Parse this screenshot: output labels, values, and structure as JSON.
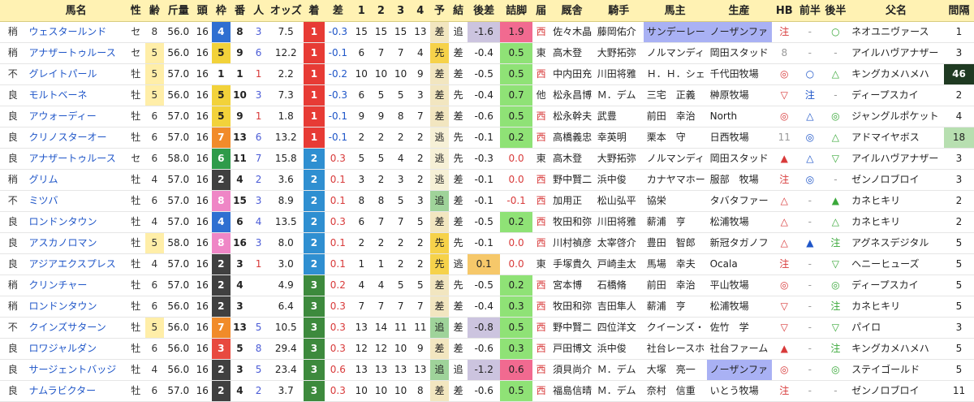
{
  "header": [
    "",
    "馬名",
    "性",
    "齢",
    "斤量",
    "頭",
    "枠",
    "番",
    "人",
    "オッズ",
    "着",
    "差",
    "1",
    "2",
    "3",
    "4",
    "予",
    "結",
    "後差",
    "詰脚",
    "届",
    "厩舎",
    "騎手",
    "馬主",
    "生産",
    "HB",
    "前半",
    "後半",
    "父名",
    "間隔"
  ],
  "colors": {
    "header_bg": "#fff2b3",
    "waku": {
      "1": "#ffffff",
      "2": "#404040",
      "3": "#e84a3f",
      "4": "#2f6fd1",
      "5": "#f2d23a",
      "6": "#2f9b4a",
      "7": "#f18b2a",
      "8": "#ef86c6"
    },
    "chaku": {
      "1": "#e73b35",
      "2": "#2f8fd1",
      "3": "#3d8a3d"
    },
    "yoso": {
      "差": "#f2e6c0",
      "先": "#f6d24a",
      "逃": "#f6f0d6",
      "追": "#9fd39a"
    },
    "kekka": {
      "差": "#f2e6c0",
      "先": "#f6d24a",
      "逃": "#f6f0d6",
      "追": "#9fd39a"
    },
    "goshi_strong": "#ccc4df",
    "tsume_high": "#f16a90",
    "tsume_good": "#8fe276",
    "tsume_neutral": "#ffffff"
  },
  "rows": [
    {
      "baba": "稍",
      "name": "ウェスタールンド",
      "sex": "セ",
      "age": "8",
      "kinryo": "56.0",
      "heads": "16",
      "waku": "4",
      "ban": "8",
      "pop": "3",
      "odds": "7.5",
      "chaku": "1",
      "sa": "-0.3",
      "c1": "15",
      "c2": "15",
      "c3": "15",
      "c4": "13",
      "yoso": "差",
      "kekka": "追",
      "goshi": "-1.6",
      "tsume": "1.9",
      "todoke": "西",
      "kyusha": "佐々木晶",
      "kishu": "藤岡佑介",
      "owner": "サンデーレー",
      "breeder": "ノーザンファ",
      "hb": "注",
      "zen": "-",
      "kou": "○",
      "father": "ネオユニヴァース",
      "kankaku": "1",
      "owner_hl": true,
      "breeder_hl": true,
      "goshi_hl": true,
      "tsume_hl": "high"
    },
    {
      "baba": "稍",
      "name": "アナザートゥルース",
      "sex": "セ",
      "age": "5",
      "kinryo": "56.0",
      "heads": "16",
      "waku": "5",
      "ban": "9",
      "pop": "6",
      "odds": "12.2",
      "chaku": "1",
      "sa": "-0.1",
      "c1": "6",
      "c2": "7",
      "c3": "7",
      "c4": "4",
      "yoso": "先",
      "kekka": "差",
      "goshi": "-0.4",
      "tsume": "0.5",
      "todoke": "東",
      "kyusha": "高木登",
      "kishu": "大野拓弥",
      "owner": "ノルマンディ",
      "breeder": "岡田スタッド",
      "hb": "8",
      "zen": "-",
      "kou": "-",
      "father": "アイルハヴアナザー",
      "kankaku": "3",
      "tsume_hl": "good"
    },
    {
      "baba": "不",
      "name": "グレイトパール",
      "sex": "牡",
      "age": "5",
      "kinryo": "57.0",
      "heads": "16",
      "waku": "1",
      "ban": "1",
      "pop": "1",
      "odds": "2.2",
      "chaku": "1",
      "sa": "-0.2",
      "c1": "10",
      "c2": "10",
      "c3": "10",
      "c4": "9",
      "yoso": "差",
      "kekka": "差",
      "goshi": "-0.5",
      "tsume": "0.5",
      "todoke": "西",
      "kyusha": "中内田充",
      "kishu": "川田将雅",
      "owner": "Ｈ．Ｈ．シェ",
      "breeder": "千代田牧場",
      "hb": "◎",
      "zen": "○",
      "kou": "△",
      "father": "キングカメハメハ",
      "kankaku": "46",
      "tsume_hl": "good",
      "kankaku_hl": "dark"
    },
    {
      "baba": "良",
      "name": "モルトベーネ",
      "sex": "牡",
      "age": "5",
      "kinryo": "56.0",
      "heads": "16",
      "waku": "5",
      "ban": "10",
      "pop": "3",
      "odds": "7.3",
      "chaku": "1",
      "sa": "-0.3",
      "c1": "6",
      "c2": "5",
      "c3": "5",
      "c4": "3",
      "yoso": "差",
      "kekka": "先",
      "goshi": "-0.4",
      "tsume": "0.7",
      "todoke": "他",
      "kyusha": "松永昌博",
      "kishu": "Ｍ．デム",
      "owner": "三宅　正義",
      "breeder": "榊原牧場",
      "hb": "▽",
      "zen": "注",
      "kou": "-",
      "father": "ディープスカイ",
      "kankaku": "2",
      "tsume_hl": "good"
    },
    {
      "baba": "良",
      "name": "アウォーディー",
      "sex": "牡",
      "age": "6",
      "kinryo": "57.0",
      "heads": "16",
      "waku": "5",
      "ban": "9",
      "pop": "1",
      "odds": "1.8",
      "chaku": "1",
      "sa": "-0.1",
      "c1": "9",
      "c2": "9",
      "c3": "8",
      "c4": "7",
      "yoso": "差",
      "kekka": "差",
      "goshi": "-0.6",
      "tsume": "0.5",
      "todoke": "西",
      "kyusha": "松永幹夫",
      "kishu": "武豊",
      "owner": "前田　幸治",
      "breeder": "North",
      "hb": "◎",
      "zen": "△",
      "kou": "◎",
      "father": "ジャングルポケット",
      "kankaku": "4",
      "tsume_hl": "good"
    },
    {
      "baba": "良",
      "name": "クリノスターオー",
      "sex": "牡",
      "age": "6",
      "kinryo": "57.0",
      "heads": "16",
      "waku": "7",
      "ban": "13",
      "pop": "6",
      "odds": "13.2",
      "chaku": "1",
      "sa": "-0.1",
      "c1": "2",
      "c2": "2",
      "c3": "2",
      "c4": "2",
      "yoso": "逃",
      "kekka": "先",
      "goshi": "-0.1",
      "tsume": "0.2",
      "todoke": "西",
      "kyusha": "高橋義忠",
      "kishu": "幸英明",
      "owner": "栗本　守",
      "breeder": "日西牧場",
      "hb": "11",
      "zen": "◎",
      "kou": "△",
      "father": "アドマイヤボス",
      "kankaku": "18",
      "tsume_hl": "good",
      "kankaku_hl": "light"
    },
    {
      "baba": "良",
      "name": "アナザートゥルース",
      "sex": "セ",
      "age": "6",
      "kinryo": "58.0",
      "heads": "16",
      "waku": "6",
      "ban": "11",
      "pop": "7",
      "odds": "15.8",
      "chaku": "2",
      "sa": "0.3",
      "c1": "5",
      "c2": "5",
      "c3": "4",
      "c4": "2",
      "yoso": "逃",
      "kekka": "先",
      "goshi": "-0.3",
      "tsume": "0.0",
      "todoke": "東",
      "kyusha": "高木登",
      "kishu": "大野拓弥",
      "owner": "ノルマンディ",
      "breeder": "岡田スタッド",
      "hb": "▲",
      "zen": "△",
      "kou": "▽",
      "father": "アイルハヴアナザー",
      "kankaku": "3"
    },
    {
      "baba": "稍",
      "name": "グリム",
      "sex": "牡",
      "age": "4",
      "kinryo": "57.0",
      "heads": "16",
      "waku": "2",
      "ban": "4",
      "pop": "2",
      "odds": "3.6",
      "chaku": "2",
      "sa": "0.1",
      "c1": "3",
      "c2": "2",
      "c3": "3",
      "c4": "2",
      "yoso": "逃",
      "kekka": "差",
      "goshi": "-0.1",
      "tsume": "0.0",
      "todoke": "西",
      "kyusha": "野中賢二",
      "kishu": "浜中俊",
      "owner": "カナヤマホー",
      "breeder": "服部　牧場",
      "hb": "注",
      "zen": "◎",
      "kou": "-",
      "father": "ゼンノロブロイ",
      "kankaku": "3"
    },
    {
      "baba": "不",
      "name": "ミツバ",
      "sex": "牡",
      "age": "6",
      "kinryo": "57.0",
      "heads": "16",
      "waku": "8",
      "ban": "15",
      "pop": "3",
      "odds": "8.9",
      "chaku": "2",
      "sa": "0.1",
      "c1": "8",
      "c2": "8",
      "c3": "5",
      "c4": "3",
      "yoso": "追",
      "kekka": "差",
      "goshi": "-0.1",
      "tsume": "-0.1",
      "todoke": "西",
      "kyusha": "加用正",
      "kishu": "松山弘平",
      "owner": "協栄",
      "breeder": "タバタファー",
      "hb": "△",
      "zen": "-",
      "kou": "▲",
      "father": "カネヒキリ",
      "kankaku": "2"
    },
    {
      "baba": "良",
      "name": "ロンドンタウン",
      "sex": "牡",
      "age": "4",
      "kinryo": "57.0",
      "heads": "16",
      "waku": "4",
      "ban": "6",
      "pop": "4",
      "odds": "13.5",
      "chaku": "2",
      "sa": "0.3",
      "c1": "6",
      "c2": "7",
      "c3": "7",
      "c4": "5",
      "yoso": "差",
      "kekka": "差",
      "goshi": "-0.5",
      "tsume": "0.2",
      "todoke": "西",
      "kyusha": "牧田和弥",
      "kishu": "川田将雅",
      "owner": "薪浦　亨",
      "breeder": "松浦牧場",
      "hb": "△",
      "zen": "-",
      "kou": "△",
      "father": "カネヒキリ",
      "kankaku": "2",
      "tsume_hl": "good"
    },
    {
      "baba": "良",
      "name": "アスカノロマン",
      "sex": "牡",
      "age": "5",
      "kinryo": "58.0",
      "heads": "16",
      "waku": "8",
      "ban": "16",
      "pop": "3",
      "odds": "8.0",
      "chaku": "2",
      "sa": "0.1",
      "c1": "2",
      "c2": "2",
      "c3": "2",
      "c4": "2",
      "yoso": "先",
      "kekka": "先",
      "goshi": "-0.1",
      "tsume": "0.0",
      "todoke": "西",
      "kyusha": "川村禎彦",
      "kishu": "太宰啓介",
      "owner": "豊田　智郎",
      "breeder": "新冠タガノフ",
      "hb": "△",
      "zen": "▲",
      "kou": "注",
      "father": "アグネスデジタル",
      "kankaku": "5"
    },
    {
      "baba": "良",
      "name": "アジアエクスプレス",
      "sex": "牡",
      "age": "4",
      "kinryo": "57.0",
      "heads": "16",
      "waku": "2",
      "ban": "3",
      "pop": "1",
      "odds": "3.0",
      "chaku": "2",
      "sa": "0.1",
      "c1": "1",
      "c2": "1",
      "c3": "2",
      "c4": "2",
      "yoso": "先",
      "kekka": "逃",
      "goshi": "0.1",
      "tsume": "0.0",
      "todoke": "東",
      "kyusha": "手塚貴久",
      "kishu": "戸崎圭太",
      "owner": "馬場　幸夫",
      "breeder": "Ocala",
      "hb": "注",
      "zen": "-",
      "kou": "▽",
      "father": "ヘニーヒューズ",
      "kankaku": "5",
      "goshi_hl": "orange"
    },
    {
      "baba": "稍",
      "name": "クリンチャー",
      "sex": "牡",
      "age": "6",
      "kinryo": "57.0",
      "heads": "16",
      "waku": "2",
      "ban": "4",
      "pop": "",
      "odds": "4.9",
      "chaku": "3",
      "sa": "0.2",
      "c1": "4",
      "c2": "4",
      "c3": "5",
      "c4": "5",
      "yoso": "差",
      "kekka": "先",
      "goshi": "-0.5",
      "tsume": "0.2",
      "todoke": "西",
      "kyusha": "宮本博",
      "kishu": "石橋脩",
      "owner": "前田　幸治",
      "breeder": "平山牧場",
      "hb": "◎",
      "zen": "-",
      "kou": "◎",
      "father": "ディープスカイ",
      "kankaku": "5",
      "tsume_hl": "good"
    },
    {
      "baba": "稍",
      "name": "ロンドンタウン",
      "sex": "牡",
      "age": "6",
      "kinryo": "56.0",
      "heads": "16",
      "waku": "2",
      "ban": "3",
      "pop": "",
      "odds": "6.4",
      "chaku": "3",
      "sa": "0.3",
      "c1": "7",
      "c2": "7",
      "c3": "7",
      "c4": "7",
      "yoso": "差",
      "kekka": "差",
      "goshi": "-0.4",
      "tsume": "0.3",
      "todoke": "西",
      "kyusha": "牧田和弥",
      "kishu": "吉田隼人",
      "owner": "薪浦　亨",
      "breeder": "松浦牧場",
      "hb": "▽",
      "zen": "-",
      "kou": "注",
      "father": "カネヒキリ",
      "kankaku": "5",
      "tsume_hl": "good"
    },
    {
      "baba": "不",
      "name": "クインズサターン",
      "sex": "牡",
      "age": "5",
      "kinryo": "56.0",
      "heads": "16",
      "waku": "7",
      "ban": "13",
      "pop": "5",
      "odds": "10.5",
      "chaku": "3",
      "sa": "0.3",
      "c1": "13",
      "c2": "14",
      "c3": "11",
      "c4": "11",
      "yoso": "追",
      "kekka": "差",
      "goshi": "-0.8",
      "tsume": "0.5",
      "todoke": "西",
      "kyusha": "野中賢二",
      "kishu": "四位洋文",
      "owner": "クイーンズ・",
      "breeder": "佐竹　学",
      "hb": "▽",
      "zen": "-",
      "kou": "▽",
      "father": "パイロ",
      "kankaku": "3",
      "tsume_hl": "good",
      "goshi_hl": true
    },
    {
      "baba": "良",
      "name": "ロワジャルダン",
      "sex": "牡",
      "age": "6",
      "kinryo": "56.0",
      "heads": "16",
      "waku": "3",
      "ban": "5",
      "pop": "8",
      "odds": "29.4",
      "chaku": "3",
      "sa": "0.3",
      "c1": "12",
      "c2": "12",
      "c3": "10",
      "c4": "9",
      "yoso": "差",
      "kekka": "差",
      "goshi": "-0.6",
      "tsume": "0.3",
      "todoke": "西",
      "kyusha": "戸田博文",
      "kishu": "浜中俊",
      "owner": "社台レースホ",
      "breeder": "社台ファーム",
      "hb": "▲",
      "zen": "-",
      "kou": "注",
      "father": "キングカメハメハ",
      "kankaku": "5",
      "tsume_hl": "good"
    },
    {
      "baba": "良",
      "name": "サージェントバッジ",
      "sex": "牡",
      "age": "4",
      "kinryo": "56.0",
      "heads": "16",
      "waku": "2",
      "ban": "3",
      "pop": "5",
      "odds": "23.4",
      "chaku": "3",
      "sa": "0.6",
      "c1": "13",
      "c2": "13",
      "c3": "13",
      "c4": "13",
      "yoso": "追",
      "kekka": "追",
      "goshi": "-1.2",
      "tsume": "0.6",
      "todoke": "西",
      "kyusha": "須貝尚介",
      "kishu": "Ｍ．デム",
      "owner": "大塚　亮一",
      "breeder": "ノーザンファ",
      "hb": "◎",
      "zen": "-",
      "kou": "◎",
      "father": "ステイゴールド",
      "kankaku": "5",
      "tsume_hl": "high",
      "goshi_hl": true,
      "breeder_hl": true
    },
    {
      "baba": "良",
      "name": "ナムラビクター",
      "sex": "牡",
      "age": "6",
      "kinryo": "57.0",
      "heads": "16",
      "waku": "2",
      "ban": "4",
      "pop": "2",
      "odds": "3.7",
      "chaku": "3",
      "sa": "0.3",
      "c1": "10",
      "c2": "10",
      "c3": "10",
      "c4": "8",
      "yoso": "差",
      "kekka": "差",
      "goshi": "-0.6",
      "tsume": "0.5",
      "todoke": "西",
      "kyusha": "福島信晴",
      "kishu": "Ｍ．デム",
      "owner": "奈村　信重",
      "breeder": "いとう牧場",
      "hb": "注",
      "zen": "-",
      "kou": "-",
      "father": "ゼンノロブロイ",
      "kankaku": "11",
      "tsume_hl": "good"
    }
  ]
}
